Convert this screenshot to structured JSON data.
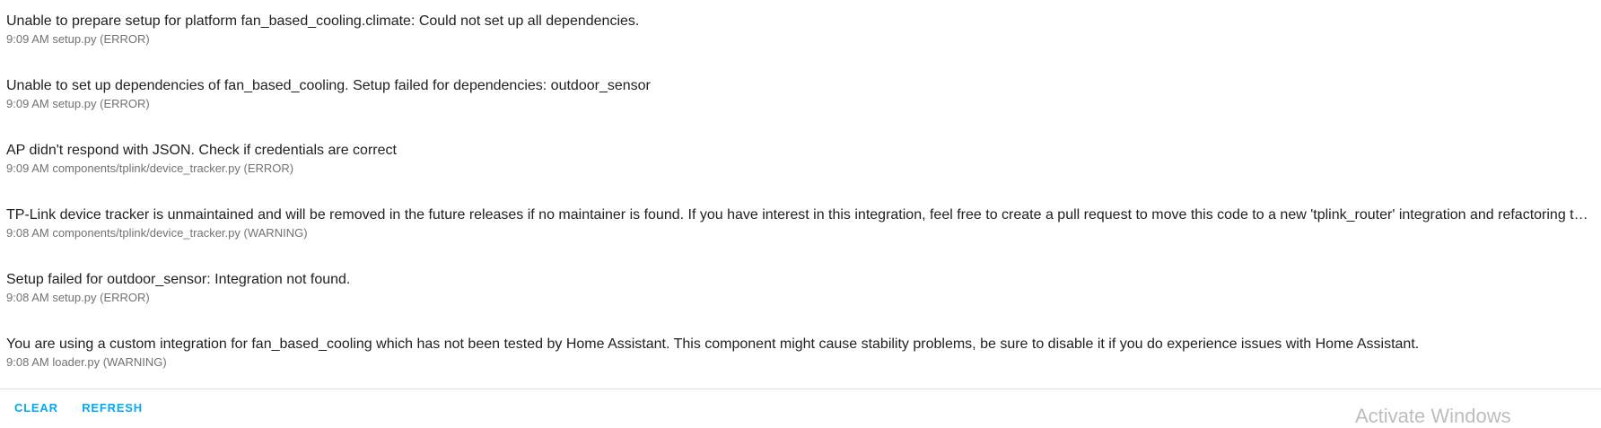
{
  "logs": [
    {
      "message": "Unable to prepare setup for platform fan_based_cooling.climate: Could not set up all dependencies.",
      "time": "9:09 AM",
      "source": "setup.py",
      "level": "(ERROR)"
    },
    {
      "message": "Unable to set up dependencies of fan_based_cooling. Setup failed for dependencies: outdoor_sensor",
      "time": "9:09 AM",
      "source": "setup.py",
      "level": "(ERROR)"
    },
    {
      "message": "AP didn't respond with JSON. Check if credentials are correct",
      "time": "9:09 AM",
      "source": "components/tplink/device_tracker.py",
      "level": "(ERROR)"
    },
    {
      "message": "TP-Link device tracker is unmaintained and will be removed in the future releases if no maintainer is found. If you have interest in this integration, feel free to create a pull request to move this code to a new 'tplink_router' integration and refactoring the device-specific parts to the tplink library",
      "time": "9:08 AM",
      "source": "components/tplink/device_tracker.py",
      "level": "(WARNING)"
    },
    {
      "message": "Setup failed for outdoor_sensor: Integration not found.",
      "time": "9:08 AM",
      "source": "setup.py",
      "level": "(ERROR)"
    },
    {
      "message": "You are using a custom integration for fan_based_cooling which has not been tested by Home Assistant. This component might cause stability problems, be sure to disable it if you do experience issues with Home Assistant.",
      "time": "9:08 AM",
      "source": "loader.py",
      "level": "(WARNING)"
    }
  ],
  "actions": {
    "clear_label": "CLEAR",
    "refresh_label": "REFRESH"
  },
  "watermark": "Activate Windows",
  "colors": {
    "accent": "#03a9f4",
    "text_primary": "#212121",
    "text_secondary": "#727272",
    "divider": "#e0e0e0"
  }
}
